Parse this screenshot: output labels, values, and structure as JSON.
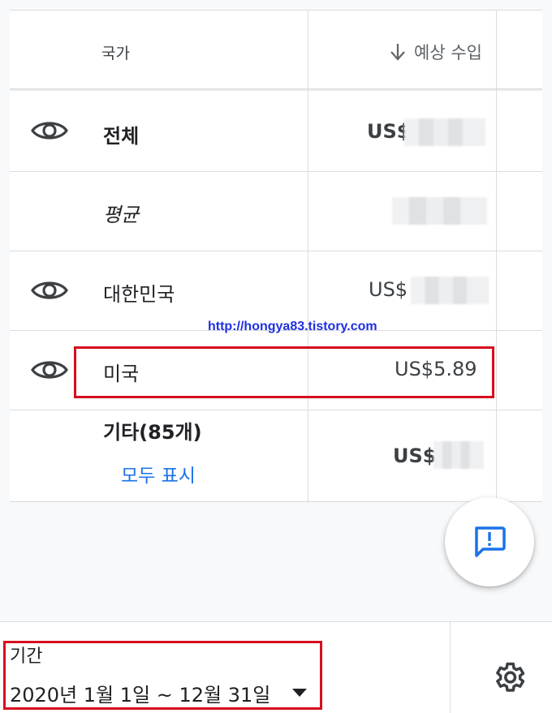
{
  "table": {
    "header": {
      "country": "국가",
      "sort_icon": "arrow-down-icon",
      "estimated_revenue": "예상 수입"
    },
    "rows": [
      {
        "label": "전체",
        "value": "US$",
        "visibility_icon": "eye-icon"
      },
      {
        "label": "평균",
        "value": ""
      },
      {
        "label": "대한민국",
        "value": "US$",
        "visibility_icon": "eye-icon"
      },
      {
        "label": "미국",
        "value": "US$5.89",
        "visibility_icon": "eye-icon"
      },
      {
        "label": "기타(85개)",
        "value": "US$",
        "link": "모두 표시"
      }
    ]
  },
  "watermark": "http://hongya83.tistory.com",
  "feedback": {
    "icon": "feedback-icon"
  },
  "bottom": {
    "period_label": "기간",
    "period_value": "2020년 1월 1일 ~ 12월 31일",
    "dropdown_icon": "caret-down-icon",
    "settings_icon": "gear-icon"
  },
  "colors": {
    "accent": "#1a73e8",
    "highlight": "#d50f1e",
    "watermark": "#1f2fe0"
  }
}
